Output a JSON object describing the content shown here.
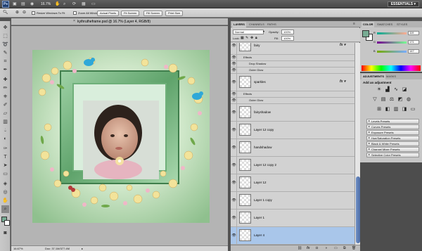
{
  "appbar": {
    "logo": "Ps",
    "zoom": "16.7%",
    "workspace": "ESSENTIALS ▾"
  },
  "options": {
    "resize_windows": "Resize Windows To Fit",
    "zoom_all_windows": "Zoom All Windows",
    "actual_pixels": "Actual Pixels",
    "fit_screen": "Fit Screen",
    "fill_screen": "Fill Screen",
    "print_size": "Print Size"
  },
  "document": {
    "title": "kythrutheframe.psd @ 16.7% (Layer 4, RGB/8)",
    "close": "×"
  },
  "status": {
    "zoom": "16.67%",
    "doc": "Doc: 37.1M/377.4M"
  },
  "layers_panel": {
    "tabs": [
      "LAYERS",
      "CHANNELS",
      "PATHS"
    ],
    "blend_mode": "Normal",
    "opacity_label": "Opacity:",
    "opacity": "100%",
    "lock_label": "Lock:",
    "fill_label": "Fill:",
    "fill": "100%",
    "rows": [
      {
        "kind": "sub",
        "text": "Effects",
        "indent": 1
      },
      {
        "kind": "sub",
        "text": "Drop Shadow",
        "indent": 2
      },
      {
        "kind": "layer",
        "name": "Layer 8",
        "fx": true
      },
      {
        "kind": "sub",
        "text": "Effects",
        "indent": 1
      },
      {
        "kind": "sub",
        "text": "Drop Shadow",
        "indent": 2
      },
      {
        "kind": "layer",
        "name": "Layer 7",
        "fx": true
      },
      {
        "kind": "sub",
        "text": "Effects",
        "indent": 1
      },
      {
        "kind": "sub",
        "text": "Drop Shadow",
        "indent": 2
      },
      {
        "kind": "layer",
        "name": "fairy",
        "fx": true
      },
      {
        "kind": "sub",
        "text": "Effects",
        "indent": 1
      },
      {
        "kind": "sub",
        "text": "Drop Shadow",
        "indent": 2
      },
      {
        "kind": "sub",
        "text": "Outer Glow",
        "indent": 2
      },
      {
        "kind": "layer",
        "name": "sparkles",
        "fx": true
      },
      {
        "kind": "sub",
        "text": "Effects",
        "indent": 1
      },
      {
        "kind": "sub",
        "text": "Outer Glow",
        "indent": 2
      },
      {
        "kind": "layer",
        "name": "fairyshadow",
        "fx": false
      },
      {
        "kind": "layer",
        "name": "Layer 12 copy",
        "fx": false
      },
      {
        "kind": "layer",
        "name": "handshadow",
        "fx": false
      },
      {
        "kind": "layer",
        "name": "Layer 12 copy 2",
        "fx": false
      },
      {
        "kind": "layer",
        "name": "Layer 12",
        "fx": false
      },
      {
        "kind": "layer",
        "name": "Layer 1 copy",
        "fx": false
      },
      {
        "kind": "layer",
        "name": "Layer 1",
        "fx": false
      },
      {
        "kind": "layer",
        "name": "Layer 4",
        "fx": false,
        "selected": true
      }
    ],
    "bottom_icons": [
      "link-icon",
      "fx-icon",
      "mask-icon",
      "adjustment-icon",
      "folder-icon",
      "new-layer-icon",
      "trash-icon"
    ]
  },
  "color_panel": {
    "tabs": [
      "COLOR",
      "SWATCHES",
      "STYLES"
    ],
    "r_label": "R",
    "g_label": "G",
    "b_label": "B",
    "r": "119",
    "g": "171",
    "b": "147",
    "foreground": "#77ab93",
    "background": "#ffffff"
  },
  "adjustments_panel": {
    "tabs": [
      "ADJUSTMENTS",
      "MASKS"
    ],
    "title": "Add an adjustment",
    "presets": [
      "Levels Presets",
      "Curves Presets",
      "Exposure Presets",
      "Hue/Saturation Presets",
      "Black & White Presets",
      "Channel Mixer Presets",
      "Selective Color Presets"
    ]
  }
}
